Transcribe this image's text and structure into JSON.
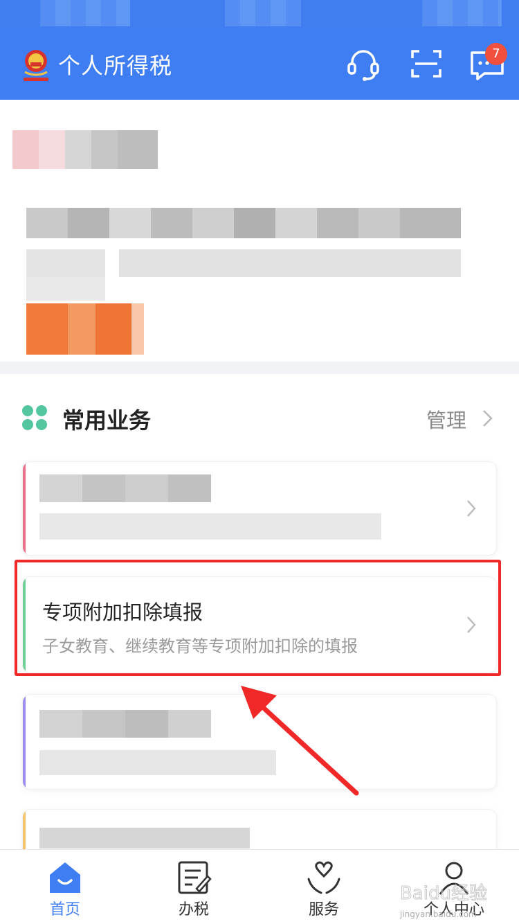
{
  "header": {
    "app_title": "个人所得税",
    "message_badge_count": "7",
    "icons": [
      "customer-service-icon",
      "scan-icon",
      "message-icon"
    ],
    "bg_color": "#3e7ef2"
  },
  "common_services": {
    "section_title": "常用业务",
    "manage_label": "管理",
    "highlighted_item": {
      "title": "专项附加扣除填报",
      "subtitle": "子女教育、继续教育等专项附加扣除的填报"
    },
    "accent_colors": [
      "#e8708a",
      "#6fcf97",
      "#9b8df0",
      "#f3c46b"
    ]
  },
  "annotation": {
    "frame_color": "#f02828"
  },
  "tab_bar": {
    "tabs": [
      {
        "label": "首页",
        "icon": "home-icon",
        "active": true
      },
      {
        "label": "办税",
        "icon": "tax-form-icon",
        "active": false
      },
      {
        "label": "服务",
        "icon": "service-heart-icon",
        "active": false
      },
      {
        "label": "个人中心",
        "icon": "person-icon",
        "active": false
      }
    ]
  },
  "watermark": {
    "brand": "Baidu经验",
    "url": "jingyan.baidu.com"
  }
}
